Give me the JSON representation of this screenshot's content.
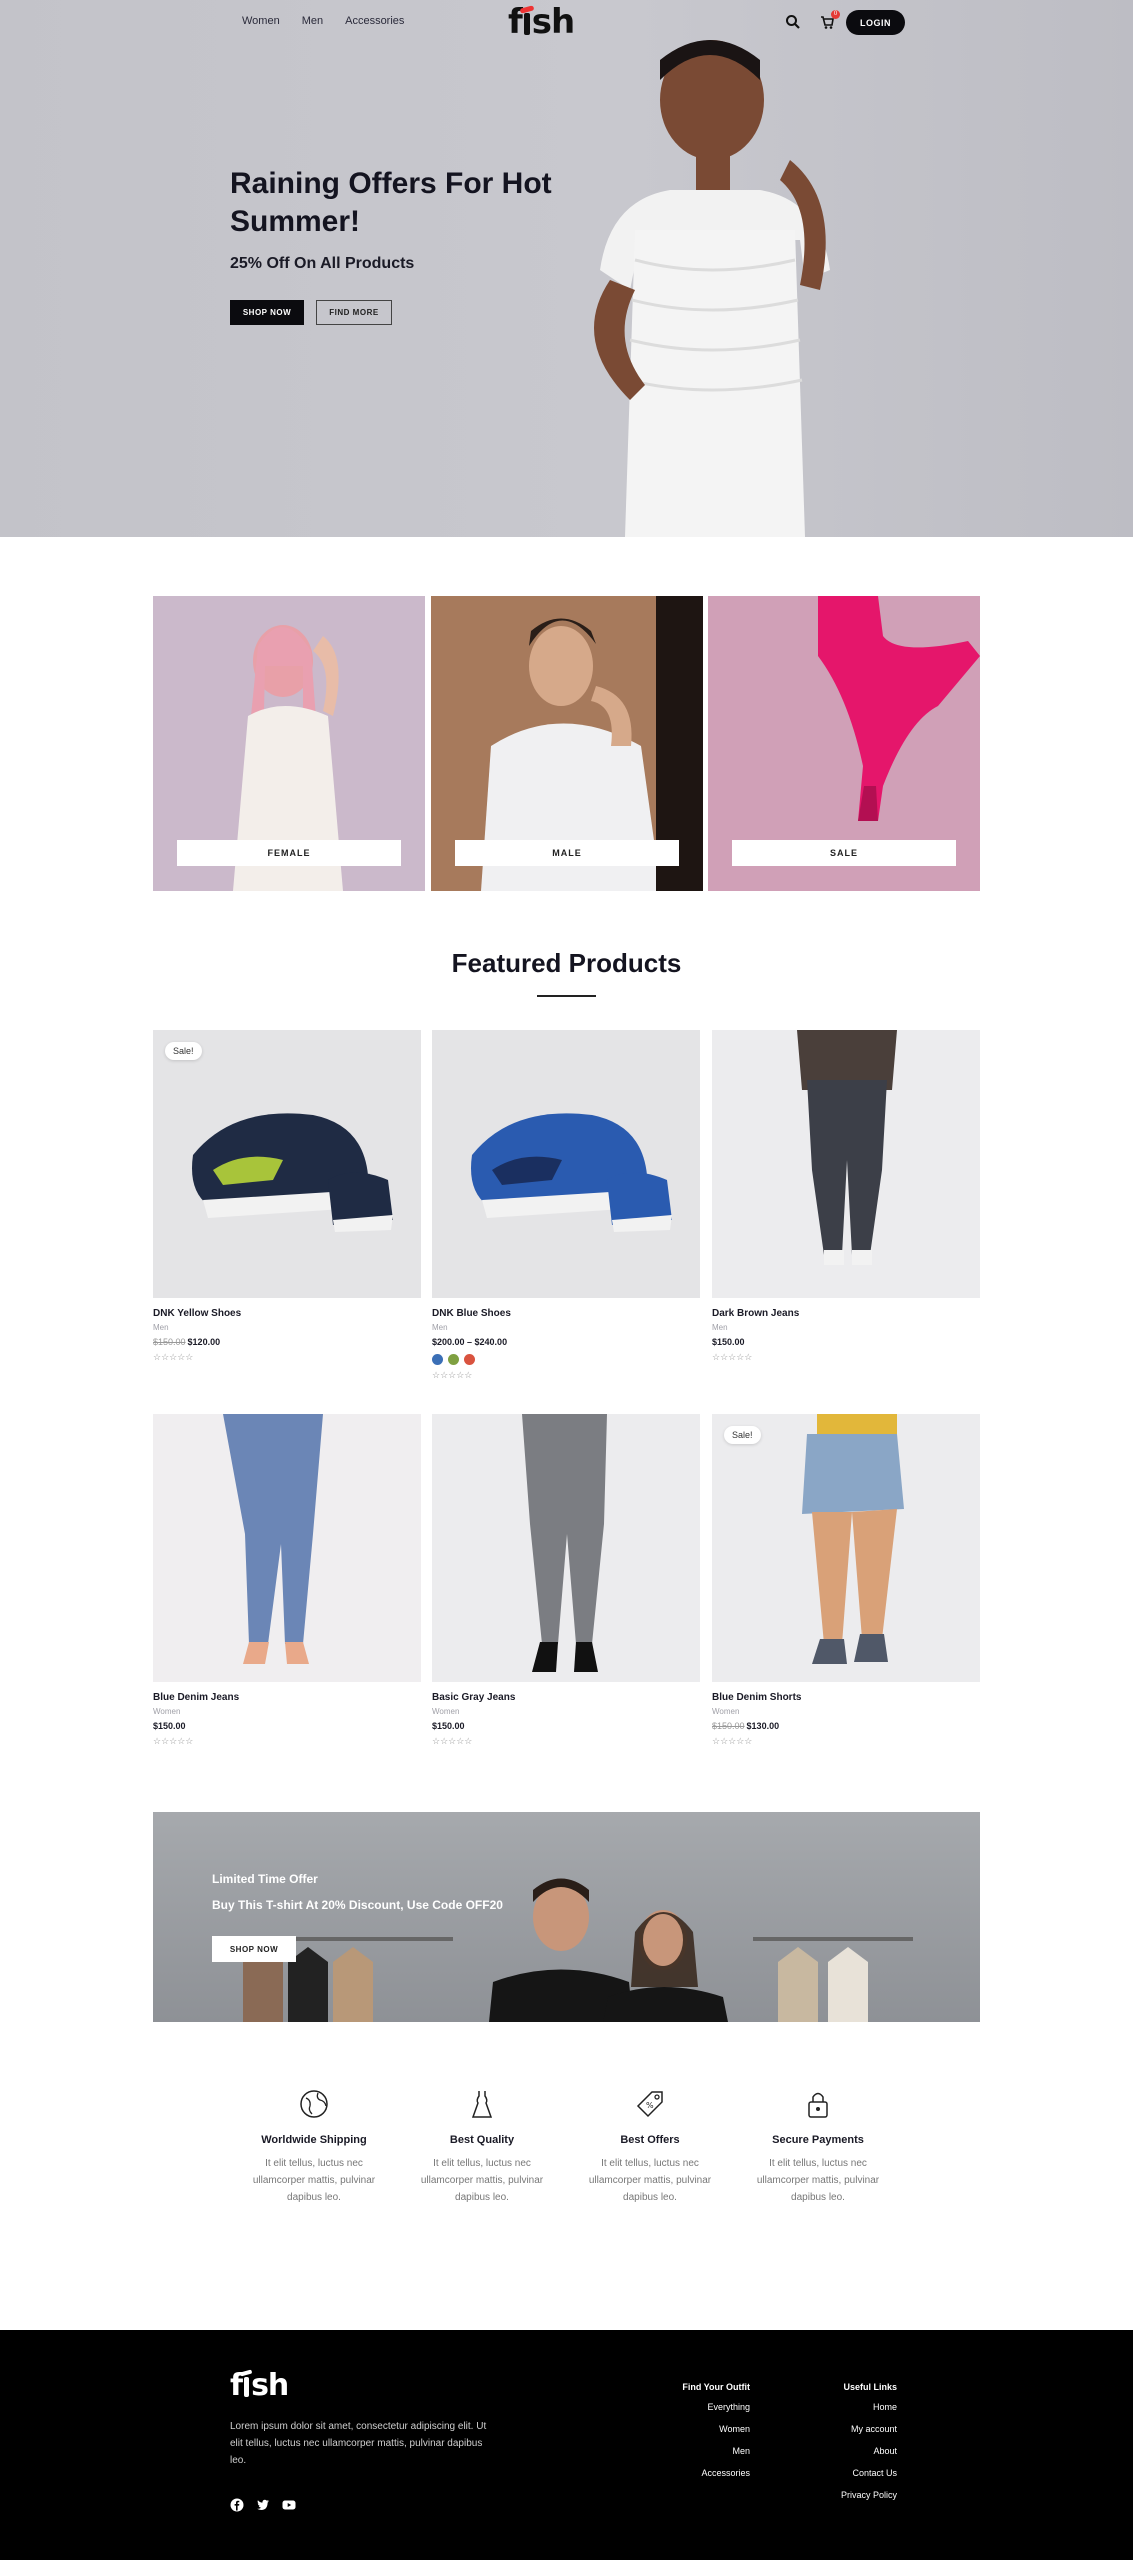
{
  "header": {
    "nav": [
      "Women",
      "Men",
      "Accessories"
    ],
    "logo": "fish",
    "cart_count": "0",
    "login": "LOGIN"
  },
  "hero": {
    "title": "Raining Offers For Hot Summer!",
    "subtitle": "25% Off On All Products",
    "shop_now": "SHOP NOW",
    "find_more": "FIND MORE"
  },
  "categories": [
    {
      "label": "FEMALE",
      "color": "#c9b6c9"
    },
    {
      "label": "MALE",
      "color": "#a77a5c"
    },
    {
      "label": "SALE",
      "color": "#cf9fb6"
    }
  ],
  "featured": {
    "title": "Featured Products",
    "products": [
      {
        "name": "DNK Yellow Shoes",
        "category": "Men",
        "old_price": "$150.00",
        "price": "$120.00",
        "sale": "Sale!",
        "stars": "☆☆☆☆☆"
      },
      {
        "name": "DNK Blue Shoes",
        "category": "Men",
        "price": "$200.00 – $240.00",
        "stars": "☆☆☆☆☆",
        "swatches": [
          "#3b6fb6",
          "#7fa041",
          "#d9533f"
        ]
      },
      {
        "name": "Dark Brown Jeans",
        "category": "Men",
        "price": "$150.00",
        "stars": "☆☆☆☆☆"
      },
      {
        "name": "Blue Denim Jeans",
        "category": "Women",
        "price": "$150.00",
        "stars": "☆☆☆☆☆"
      },
      {
        "name": "Basic Gray Jeans",
        "category": "Women",
        "price": "$150.00",
        "stars": "☆☆☆☆☆"
      },
      {
        "name": "Blue Denim Shorts",
        "category": "Women",
        "old_price": "$150.00",
        "price": "$130.00",
        "sale": "Sale!",
        "stars": "☆☆☆☆☆"
      }
    ]
  },
  "promo": {
    "title": "Limited Time Offer",
    "text": "Buy This T-shirt At 20% Discount, Use Code OFF20",
    "button": "SHOP NOW"
  },
  "features": [
    {
      "title": "Worldwide Shipping",
      "text": "It elit tellus, luctus nec ullamcorper mattis, pulvinar dapibus leo.",
      "icon": "globe-icon"
    },
    {
      "title": "Best Quality",
      "text": "It elit tellus, luctus nec ullamcorper mattis, pulvinar dapibus leo.",
      "icon": "dress-icon"
    },
    {
      "title": "Best Offers",
      "text": "It elit tellus, luctus nec ullamcorper mattis, pulvinar dapibus leo.",
      "icon": "price-tag-icon"
    },
    {
      "title": "Secure Payments",
      "text": "It elit tellus, luctus nec ullamcorper mattis, pulvinar dapibus leo.",
      "icon": "lock-icon"
    }
  ],
  "footer": {
    "logo": "fish",
    "about": "Lorem ipsum dolor sit amet, consectetur adipiscing elit. Ut elit tellus, luctus nec ullamcorper mattis, pulvinar dapibus leo.",
    "col1": {
      "title": "Find Your Outfit",
      "links": [
        "Everything",
        "Women",
        "Men",
        "Accessories"
      ]
    },
    "col2": {
      "title": "Useful Links",
      "links": [
        "Home",
        "My account",
        "About",
        "Contact Us",
        "Privacy Policy"
      ]
    }
  }
}
